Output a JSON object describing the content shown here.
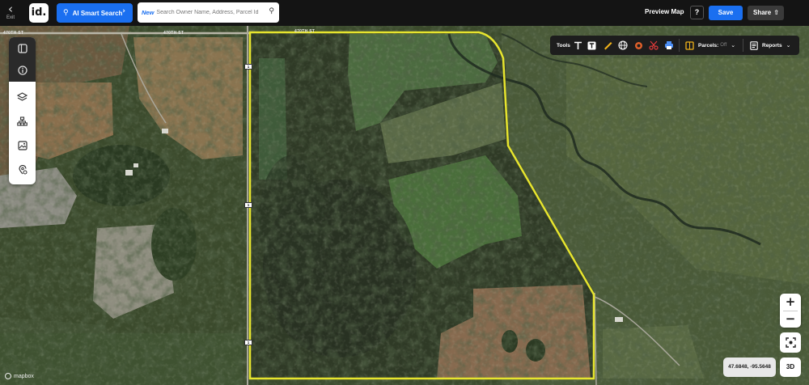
{
  "topbar": {
    "exit_label": "Exit",
    "logo_text": "id.",
    "ai_search_label": "AI Smart Search",
    "search_new_tag": "New",
    "search_placeholder": "Search Owner Name, Address, Parcel Id",
    "preview_label": "Preview Map",
    "help_label": "?",
    "save_label": "Save",
    "share_label": "Share"
  },
  "left_panel": {
    "icons": [
      "panel-toggle-icon",
      "info-icon",
      "layers-icon",
      "hierarchy-icon",
      "image-icon",
      "location-settings-icon"
    ]
  },
  "toolbar": {
    "tools_label": "Tools",
    "tool_icons": [
      "text-icon",
      "text-box-icon",
      "ruler-icon",
      "globe-icon",
      "circle-icon",
      "scissors-icon",
      "print-icon"
    ],
    "parcels_label": "Parcels:",
    "parcels_state": "Off",
    "reports_label": "Reports"
  },
  "map": {
    "road_labels": [
      "470TH ST",
      "470TH ST",
      "470TH ST"
    ],
    "shields": [
      "1",
      "1",
      "1"
    ],
    "attribution": "mapbox",
    "parcel_outline_color": "#e7e52e"
  },
  "controls": {
    "zoom_in": "+",
    "zoom_out": "−",
    "coordinates": "47.6848, -95.5648",
    "mode_3d": "3D"
  }
}
